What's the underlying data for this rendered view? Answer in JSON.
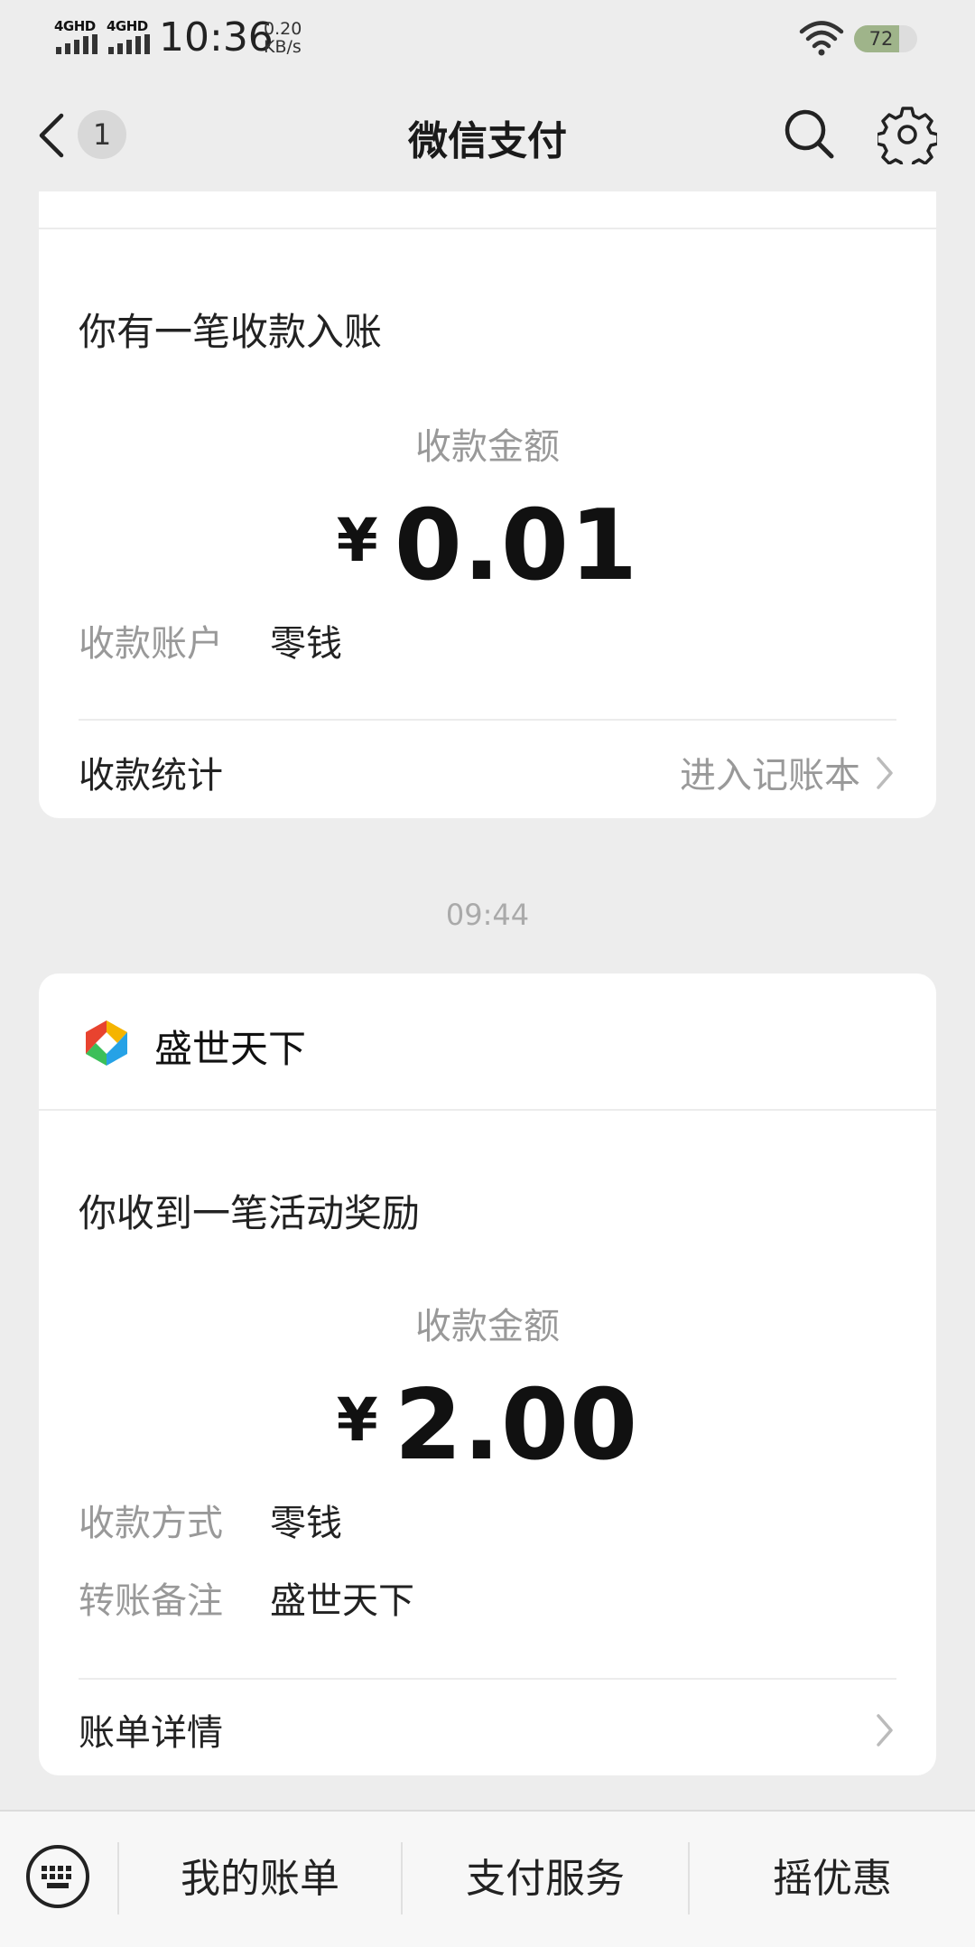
{
  "status_bar": {
    "signal1": "4GHD",
    "signal2": "4GHD",
    "time": "10:36",
    "speed_value": "0.20",
    "speed_unit": "KB/s",
    "battery": "72",
    "battery_level": 0.72
  },
  "nav": {
    "title": "微信支付",
    "back_badge": "1"
  },
  "card1": {
    "heading": "你有一笔收款入账",
    "amount_label": "收款金额",
    "currency": "¥",
    "amount": "0.01",
    "fields": [
      {
        "key": "收款账户",
        "value": "零钱"
      }
    ],
    "footer_label": "收款统计",
    "footer_link": "进入记账本"
  },
  "timestamp": "09:44",
  "card2": {
    "merchant": "盛世天下",
    "heading": "你收到一笔活动奖励",
    "amount_label": "收款金额",
    "currency": "¥",
    "amount": "2.00",
    "fields": [
      {
        "key": "收款方式",
        "value": "零钱"
      },
      {
        "key": "转账备注",
        "value": "盛世天下"
      }
    ],
    "footer_label": "账单详情"
  },
  "bottom_menu": [
    "我的账单",
    "支付服务",
    "摇优惠"
  ],
  "icons": [
    "back-arrow-icon",
    "search-icon",
    "gear-icon",
    "keyboard-icon",
    "chevron-right-icon",
    "merchant-logo-icon",
    "wifi-icon",
    "signal-icon"
  ]
}
